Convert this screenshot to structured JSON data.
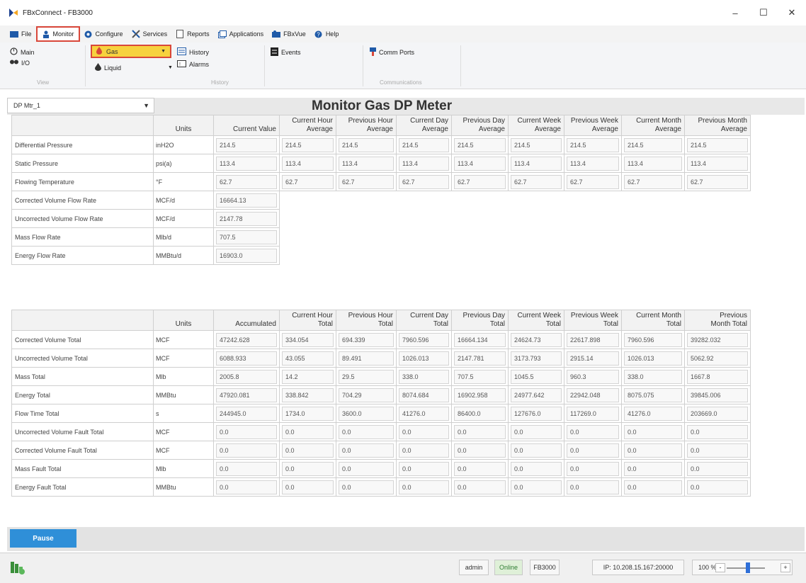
{
  "window": {
    "title": "FBxConnect - FB3000",
    "minimize": "–",
    "maximize": "☐",
    "close": "✕"
  },
  "menu": [
    {
      "label": "File"
    },
    {
      "label": "Monitor"
    },
    {
      "label": "Configure"
    },
    {
      "label": "Services"
    },
    {
      "label": "Reports"
    },
    {
      "label": "Applications"
    },
    {
      "label": "FBxVue"
    },
    {
      "label": "Help"
    }
  ],
  "ribbon": {
    "main": "Main",
    "io": "I/O",
    "gas": "Gas",
    "liquid": "Liquid",
    "history": "History",
    "alarms": "Alarms",
    "events": "Events",
    "comm_ports": "Comm Ports",
    "group_view": "View",
    "group_history": "History",
    "group_communications": "Communications"
  },
  "meter": {
    "selected": "DP Mtr_1",
    "page_title": "Monitor Gas DP Meter"
  },
  "rates": {
    "headers": {
      "units": "Units",
      "current_value": "Current Value",
      "averages": [
        [
          "Current Hour",
          "Average"
        ],
        [
          "Previous Hour",
          "Average"
        ],
        [
          "Current Day",
          "Average"
        ],
        [
          "Previous Day",
          "Average"
        ],
        [
          "Current Week",
          "Average"
        ],
        [
          "Previous Week",
          "Average"
        ],
        [
          "Current Month",
          "Average"
        ],
        [
          "Previous Month",
          "Average"
        ]
      ]
    },
    "rows": [
      {
        "label": "Differential Pressure",
        "units": "inH2O",
        "value": "214.5",
        "avgs": [
          "214.5",
          "214.5",
          "214.5",
          "214.5",
          "214.5",
          "214.5",
          "214.5",
          "214.5"
        ]
      },
      {
        "label": "Static Pressure",
        "units": "psi(a)",
        "value": "113.4",
        "avgs": [
          "113.4",
          "113.4",
          "113.4",
          "113.4",
          "113.4",
          "113.4",
          "113.4",
          "113.4"
        ]
      },
      {
        "label": "Flowing Temperature",
        "units": "°F",
        "value": "62.7",
        "avgs": [
          "62.7",
          "62.7",
          "62.7",
          "62.7",
          "62.7",
          "62.7",
          "62.7",
          "62.7"
        ]
      },
      {
        "label": "Corrected Volume Flow Rate",
        "units": "MCF/d",
        "value": "16664.13",
        "avgs": []
      },
      {
        "label": "Uncorrected Volume Flow Rate",
        "units": "MCF/d",
        "value": "2147.78",
        "avgs": []
      },
      {
        "label": "Mass Flow Rate",
        "units": "Mlb/d",
        "value": "707.5",
        "avgs": []
      },
      {
        "label": "Energy Flow Rate",
        "units": "MMBtu/d",
        "value": "16903.0",
        "avgs": []
      }
    ]
  },
  "totals": {
    "headers": {
      "units": "Units",
      "accumulated": "Accumulated",
      "periods": [
        [
          "Current Hour",
          "Total"
        ],
        [
          "Previous Hour",
          "Total"
        ],
        [
          "Current Day",
          "Total"
        ],
        [
          "Previous Day",
          "Total"
        ],
        [
          "Current Week",
          "Total"
        ],
        [
          "Previous Week",
          "Total"
        ],
        [
          "Current Month",
          "Total"
        ],
        [
          "Previous",
          "Month Total"
        ]
      ]
    },
    "rows": [
      {
        "label": "Corrected Volume Total",
        "units": "MCF",
        "accumulated": "47242.628",
        "vals": [
          "334.054",
          "694.339",
          "7960.596",
          "16664.134",
          "24624.73",
          "22617.898",
          "7960.596",
          "39282.032"
        ]
      },
      {
        "label": "Uncorrected Volume Total",
        "units": "MCF",
        "accumulated": "6088.933",
        "vals": [
          "43.055",
          "89.491",
          "1026.013",
          "2147.781",
          "3173.793",
          "2915.14",
          "1026.013",
          "5062.92"
        ]
      },
      {
        "label": "Mass Total",
        "units": "Mlb",
        "accumulated": "2005.8",
        "vals": [
          "14.2",
          "29.5",
          "338.0",
          "707.5",
          "1045.5",
          "960.3",
          "338.0",
          "1667.8"
        ]
      },
      {
        "label": "Energy Total",
        "units": "MMBtu",
        "accumulated": "47920.081",
        "vals": [
          "338.842",
          "704.29",
          "8074.684",
          "16902.958",
          "24977.642",
          "22942.048",
          "8075.075",
          "39845.006"
        ]
      },
      {
        "label": "Flow Time Total",
        "units": "s",
        "accumulated": "244945.0",
        "vals": [
          "1734.0",
          "3600.0",
          "41276.0",
          "86400.0",
          "127676.0",
          "117269.0",
          "41276.0",
          "203669.0"
        ]
      },
      {
        "label": "Uncorrected Volume Fault Total",
        "units": "MCF",
        "accumulated": "0.0",
        "vals": [
          "0.0",
          "0.0",
          "0.0",
          "0.0",
          "0.0",
          "0.0",
          "0.0",
          "0.0"
        ]
      },
      {
        "label": "Corrected Volume Fault Total",
        "units": "MCF",
        "accumulated": "0.0",
        "vals": [
          "0.0",
          "0.0",
          "0.0",
          "0.0",
          "0.0",
          "0.0",
          "0.0",
          "0.0"
        ]
      },
      {
        "label": "Mass Fault Total",
        "units": "Mlb",
        "accumulated": "0.0",
        "vals": [
          "0.0",
          "0.0",
          "0.0",
          "0.0",
          "0.0",
          "0.0",
          "0.0",
          "0.0"
        ]
      },
      {
        "label": "Energy Fault Total",
        "units": "MMBtu",
        "accumulated": "0.0",
        "vals": [
          "0.0",
          "0.0",
          "0.0",
          "0.0",
          "0.0",
          "0.0",
          "0.0",
          "0.0"
        ]
      }
    ]
  },
  "controls": {
    "pause": "Pause"
  },
  "status": {
    "user": "admin",
    "connection": "Online",
    "device": "FB3000",
    "ip": "IP: 10.208.15.167:20000",
    "zoom": "100 %",
    "zoom_minus": "-",
    "zoom_plus": "+"
  },
  "colors": {
    "accent_blue": "#2f8fd8",
    "highlight_yellow": "#f7d23e",
    "highlight_red": "#d9473a"
  }
}
